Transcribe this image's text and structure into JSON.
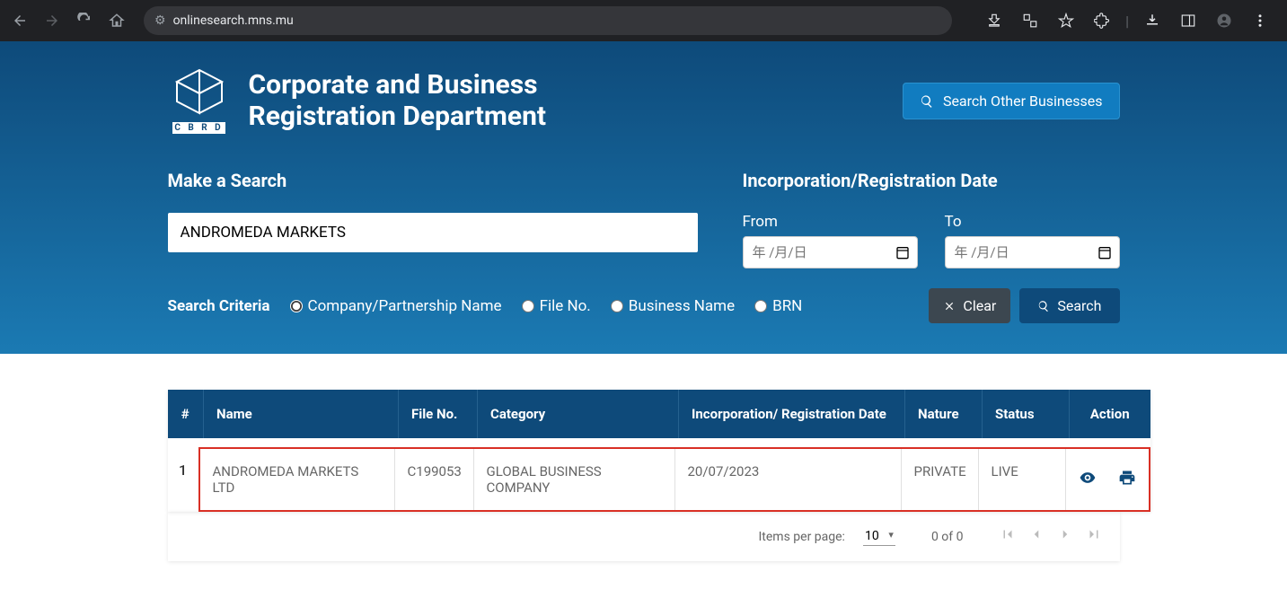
{
  "browser": {
    "url": "onlinesearch.mns.mu"
  },
  "header": {
    "title_line1": "Corporate and Business",
    "title_line2": "Registration Department",
    "logo_letters": "C B R D",
    "other_button": "Search Other Businesses"
  },
  "search": {
    "make_label": "Make a Search",
    "input_value": "ANDROMEDA MARKETS",
    "date_section": "Incorporation/Registration Date",
    "from_label": "From",
    "to_label": "To",
    "date_placeholder": "年 /月/日",
    "criteria_label": "Search Criteria",
    "criteria": [
      {
        "label": "Company/Partnership Name",
        "checked": true
      },
      {
        "label": "File No.",
        "checked": false
      },
      {
        "label": "Business Name",
        "checked": false
      },
      {
        "label": "BRN",
        "checked": false
      }
    ],
    "clear_btn": "Clear",
    "search_btn": "Search"
  },
  "table": {
    "headers": {
      "idx": "#",
      "name": "Name",
      "file": "File No.",
      "category": "Category",
      "date": "Incorporation/ Registration Date",
      "nature": "Nature",
      "status": "Status",
      "action": "Action"
    },
    "rows": [
      {
        "idx": "1",
        "name": "ANDROMEDA MARKETS LTD",
        "file": "C199053",
        "category": "GLOBAL BUSINESS COMPANY",
        "date": "20/07/2023",
        "nature": "PRIVATE",
        "status": "LIVE"
      }
    ]
  },
  "paginator": {
    "items_label": "Items per page:",
    "page_size": "10",
    "range": "0 of 0"
  }
}
